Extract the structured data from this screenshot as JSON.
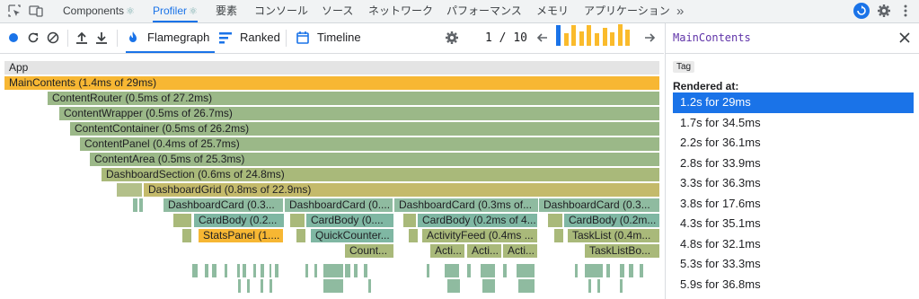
{
  "tabstrip": {
    "tabs": [
      {
        "label": "Components",
        "ext": "⚛"
      },
      {
        "label": "Profiler",
        "ext": "⚛"
      },
      {
        "label": "要素"
      },
      {
        "label": "コンソール"
      },
      {
        "label": "ソース"
      },
      {
        "label": "ネットワーク"
      },
      {
        "label": "パフォーマンス"
      },
      {
        "label": "メモリ"
      },
      {
        "label": "アプリケーション"
      }
    ],
    "more": "»"
  },
  "toolbar": {
    "views": [
      {
        "label": "Flamegraph",
        "icon": "flame-icon"
      },
      {
        "label": "Ranked",
        "icon": "ranked-icon"
      },
      {
        "label": "Timeline",
        "icon": "timeline-icon"
      }
    ],
    "commit_index": "1",
    "commit_sep": "/",
    "commit_total": "10",
    "commit_values": [
      0.9,
      0.55,
      0.9,
      0.65,
      0.9,
      0.55,
      0.8,
      0.6,
      0.95,
      0.7
    ],
    "colors": {
      "selected": "#1a73e8",
      "bar": "#fabb2c"
    }
  },
  "flamegraph": {
    "root": "App",
    "rows": [
      [
        {
          "label": "MainContents (1.4ms of 29ms)",
          "color": "#f7b733"
        }
      ],
      [
        {
          "label": "ContentRouter (0.5ms of 27.2ms)",
          "color": "#9bb888"
        }
      ],
      [
        {
          "label": "ContentWrapper (0.5ms of 26.7ms)",
          "color": "#9bb888"
        }
      ],
      [
        {
          "label": "ContentContainer (0.5ms of 26.2ms)",
          "color": "#9bb888"
        }
      ],
      [
        {
          "label": "ContentPanel (0.4ms of 25.7ms)",
          "color": "#9bb888"
        }
      ],
      [
        {
          "label": "ContentArea (0.5ms of 25.3ms)",
          "color": "#9bb888"
        }
      ],
      [
        {
          "label": "DashboardSection (0.6ms of 24.8ms)",
          "color": "#a9b97a"
        }
      ],
      [
        {
          "label": "",
          "color": "#b3c08a"
        },
        {
          "label": "DashboardGrid (0.8ms of 22.9ms)",
          "color": "#c4ba6b"
        }
      ],
      [
        {
          "label": "",
          "color": "#8fbba0"
        },
        {
          "label": "",
          "color": "#8fbba0"
        },
        {
          "label": "DashboardCard (0.3...",
          "color": "#8fbba0"
        },
        {
          "label": "DashboardCard (0....",
          "color": "#8fbba0"
        },
        {
          "label": "DashboardCard (0.3ms of...",
          "color": "#8fbba0"
        },
        {
          "label": "DashboardCard (0.3...",
          "color": "#8fbba0"
        }
      ],
      [
        {
          "label": "",
          "color": "#a9b97a"
        },
        {
          "label": "CardBody (0.2...",
          "color": "#7fb7a3"
        },
        {
          "label": "",
          "color": "#a9b97a"
        },
        {
          "label": "CardBody (0....",
          "color": "#7fb7a3"
        },
        {
          "label": "",
          "color": "#a9b97a"
        },
        {
          "label": "CardBody (0.2ms of 4...",
          "color": "#7fb7a3"
        },
        {
          "label": "",
          "color": "#a9b97a"
        },
        {
          "label": "CardBody (0.2m...",
          "color": "#7fb7a3"
        }
      ],
      [
        {
          "label": "",
          "color": "#a9b97a"
        },
        {
          "label": "StatsPanel (1....",
          "color": "#f7b733"
        },
        {
          "label": "",
          "color": "#a9b97a"
        },
        {
          "label": "QuickCounter...",
          "color": "#7fb7a3"
        },
        {
          "label": "",
          "color": "#a9b97a"
        },
        {
          "label": "ActivityFeed (0.4ms ...",
          "color": "#a9b97a"
        },
        {
          "label": "",
          "color": "#a9b97a"
        },
        {
          "label": "TaskList (0.4m...",
          "color": "#a9b97a"
        }
      ],
      [
        {
          "label": "Count...",
          "color": "#a9b97a"
        },
        {
          "label": "Acti...",
          "color": "#a9b97a"
        },
        {
          "label": "Acti...",
          "color": "#a9b97a"
        },
        {
          "label": "Acti...",
          "color": "#a9b97a"
        },
        {
          "label": "TaskListBo...",
          "color": "#a9b97a"
        }
      ]
    ]
  },
  "sidepanel": {
    "title": "MainContents",
    "tag": "Tag",
    "rendered_at": "Rendered at:",
    "renders": [
      "1.2s for 29ms",
      "1.7s for 34.5ms",
      "2.2s for 36.1ms",
      "2.8s for 33.9ms",
      "3.3s for 36.3ms",
      "3.8s for 17.6ms",
      "4.3s for 35.1ms",
      "4.8s for 32.1ms",
      "5.3s for 33.3ms",
      "5.9s for 36.8ms"
    ]
  }
}
